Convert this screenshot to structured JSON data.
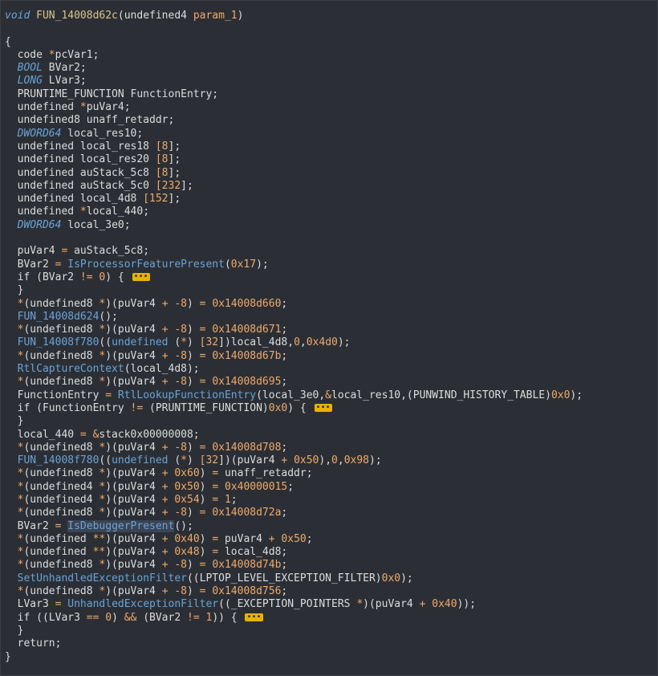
{
  "colors": {
    "background": "#2b2f35",
    "keyword_type": "#6aa3d8",
    "function_name": "#6aa3d8",
    "function_def": "#d7c58a",
    "number": "#f0a96a",
    "fold_marker": "#e8b300"
  },
  "lines": [
    [
      {
        "t": "void",
        "c": "type"
      },
      {
        "t": " "
      },
      {
        "t": "FUN_14008d62c",
        "c": "def"
      },
      {
        "t": "(undefined4 "
      },
      {
        "t": "param_1",
        "c": "param"
      },
      {
        "t": ")"
      }
    ],
    [],
    [
      {
        "t": "{"
      }
    ],
    [
      {
        "t": "  code "
      },
      {
        "t": "*",
        "c": "op"
      },
      {
        "t": "pcVar1;"
      }
    ],
    [
      {
        "t": "  "
      },
      {
        "t": "BOOL",
        "c": "type"
      },
      {
        "t": " BVar2;"
      }
    ],
    [
      {
        "t": "  "
      },
      {
        "t": "LONG",
        "c": "type"
      },
      {
        "t": " LVar3;"
      }
    ],
    [
      {
        "t": "  PRUNTIME_FUNCTION FunctionEntry;"
      }
    ],
    [
      {
        "t": "  undefined "
      },
      {
        "t": "*",
        "c": "op"
      },
      {
        "t": "puVar4;"
      }
    ],
    [
      {
        "t": "  undefined8 unaff_retaddr;"
      }
    ],
    [
      {
        "t": "  "
      },
      {
        "t": "DWORD64",
        "c": "type"
      },
      {
        "t": " local_res10;"
      }
    ],
    [
      {
        "t": "  undefined local_res18 "
      },
      {
        "t": "[",
        "c": "op"
      },
      {
        "t": "8",
        "c": "num"
      },
      {
        "t": "];"
      }
    ],
    [
      {
        "t": "  undefined local_res20 "
      },
      {
        "t": "[",
        "c": "op"
      },
      {
        "t": "8",
        "c": "num"
      },
      {
        "t": "];"
      }
    ],
    [
      {
        "t": "  undefined auStack_5c8 "
      },
      {
        "t": "[",
        "c": "op"
      },
      {
        "t": "8",
        "c": "num"
      },
      {
        "t": "];"
      }
    ],
    [
      {
        "t": "  undefined auStack_5c0 "
      },
      {
        "t": "[",
        "c": "op"
      },
      {
        "t": "232",
        "c": "num"
      },
      {
        "t": "];"
      }
    ],
    [
      {
        "t": "  undefined local_4d8 "
      },
      {
        "t": "[",
        "c": "op"
      },
      {
        "t": "152",
        "c": "num"
      },
      {
        "t": "];"
      }
    ],
    [
      {
        "t": "  undefined "
      },
      {
        "t": "*",
        "c": "op"
      },
      {
        "t": "local_440;"
      }
    ],
    [
      {
        "t": "  "
      },
      {
        "t": "DWORD64",
        "c": "type"
      },
      {
        "t": " local_3e0;"
      }
    ],
    [],
    [
      {
        "t": "  puVar4 "
      },
      {
        "t": "=",
        "c": "op"
      },
      {
        "t": " auStack_5c8;"
      }
    ],
    [
      {
        "t": "  BVar2 "
      },
      {
        "t": "=",
        "c": "op"
      },
      {
        "t": " "
      },
      {
        "t": "IsProcessorFeaturePresent",
        "c": "fn"
      },
      {
        "t": "("
      },
      {
        "t": "0x17",
        "c": "num"
      },
      {
        "t": ");"
      }
    ],
    [
      {
        "t": "  if (BVar2 "
      },
      {
        "t": "!=",
        "c": "op"
      },
      {
        "t": " "
      },
      {
        "t": "0",
        "c": "num"
      },
      {
        "t": ") { "
      },
      {
        "t": "•••",
        "c": "fold"
      }
    ],
    [
      {
        "t": "  }"
      }
    ],
    [
      {
        "t": "  "
      },
      {
        "t": "*",
        "c": "op"
      },
      {
        "t": "(undefined8 "
      },
      {
        "t": "*",
        "c": "op"
      },
      {
        "t": ")(puVar4 "
      },
      {
        "t": "+",
        "c": "op"
      },
      {
        "t": " "
      },
      {
        "t": "-8",
        "c": "num"
      },
      {
        "t": ") "
      },
      {
        "t": "=",
        "c": "op"
      },
      {
        "t": " "
      },
      {
        "t": "0x14008d660",
        "c": "num"
      },
      {
        "t": ";"
      }
    ],
    [
      {
        "t": "  "
      },
      {
        "t": "FUN_14008d624",
        "c": "fn"
      },
      {
        "t": "();"
      }
    ],
    [
      {
        "t": "  "
      },
      {
        "t": "*",
        "c": "op"
      },
      {
        "t": "(undefined8 "
      },
      {
        "t": "*",
        "c": "op"
      },
      {
        "t": ")(puVar4 "
      },
      {
        "t": "+",
        "c": "op"
      },
      {
        "t": " "
      },
      {
        "t": "-8",
        "c": "num"
      },
      {
        "t": ") "
      },
      {
        "t": "=",
        "c": "op"
      },
      {
        "t": " "
      },
      {
        "t": "0x14008d671",
        "c": "num"
      },
      {
        "t": ";"
      }
    ],
    [
      {
        "t": "  "
      },
      {
        "t": "FUN_14008f780",
        "c": "fn"
      },
      {
        "t": "(("
      },
      {
        "t": "undefined",
        "c": "fn"
      },
      {
        "t": " ("
      },
      {
        "t": "*",
        "c": "op"
      },
      {
        "t": ") "
      },
      {
        "t": "[",
        "c": "op"
      },
      {
        "t": "32",
        "c": "num"
      },
      {
        "t": "])local_4d8,"
      },
      {
        "t": "0",
        "c": "num"
      },
      {
        "t": ","
      },
      {
        "t": "0x4d0",
        "c": "num"
      },
      {
        "t": ");"
      }
    ],
    [
      {
        "t": "  "
      },
      {
        "t": "*",
        "c": "op"
      },
      {
        "t": "(undefined8 "
      },
      {
        "t": "*",
        "c": "op"
      },
      {
        "t": ")(puVar4 "
      },
      {
        "t": "+",
        "c": "op"
      },
      {
        "t": " "
      },
      {
        "t": "-8",
        "c": "num"
      },
      {
        "t": ") "
      },
      {
        "t": "=",
        "c": "op"
      },
      {
        "t": " "
      },
      {
        "t": "0x14008d67b",
        "c": "num"
      },
      {
        "t": ";"
      }
    ],
    [
      {
        "t": "  "
      },
      {
        "t": "RtlCaptureContext",
        "c": "fn"
      },
      {
        "t": "(local_4d8);"
      }
    ],
    [
      {
        "t": "  "
      },
      {
        "t": "*",
        "c": "op"
      },
      {
        "t": "(undefined8 "
      },
      {
        "t": "*",
        "c": "op"
      },
      {
        "t": ")(puVar4 "
      },
      {
        "t": "+",
        "c": "op"
      },
      {
        "t": " "
      },
      {
        "t": "-8",
        "c": "num"
      },
      {
        "t": ") "
      },
      {
        "t": "=",
        "c": "op"
      },
      {
        "t": " "
      },
      {
        "t": "0x14008d695",
        "c": "num"
      },
      {
        "t": ";"
      }
    ],
    [
      {
        "t": "  FunctionEntry "
      },
      {
        "t": "=",
        "c": "op"
      },
      {
        "t": " "
      },
      {
        "t": "RtlLookupFunctionEntry",
        "c": "fn"
      },
      {
        "t": "(local_3e0,"
      },
      {
        "t": "&",
        "c": "op"
      },
      {
        "t": "local_res10,(PUNWIND_HISTORY_TABLE)"
      },
      {
        "t": "0x0",
        "c": "num"
      },
      {
        "t": ");"
      }
    ],
    [
      {
        "t": "  if (FunctionEntry "
      },
      {
        "t": "!=",
        "c": "op"
      },
      {
        "t": " (PRUNTIME_FUNCTION)"
      },
      {
        "t": "0x0",
        "c": "num"
      },
      {
        "t": ") { "
      },
      {
        "t": "•••",
        "c": "fold"
      }
    ],
    [
      {
        "t": "  }"
      }
    ],
    [
      {
        "t": "  local_440 "
      },
      {
        "t": "=",
        "c": "op"
      },
      {
        "t": " "
      },
      {
        "t": "&",
        "c": "op"
      },
      {
        "t": "stack0x00000008;"
      }
    ],
    [
      {
        "t": "  "
      },
      {
        "t": "*",
        "c": "op"
      },
      {
        "t": "(undefined8 "
      },
      {
        "t": "*",
        "c": "op"
      },
      {
        "t": ")(puVar4 "
      },
      {
        "t": "+",
        "c": "op"
      },
      {
        "t": " "
      },
      {
        "t": "-8",
        "c": "num"
      },
      {
        "t": ") "
      },
      {
        "t": "=",
        "c": "op"
      },
      {
        "t": " "
      },
      {
        "t": "0x14008d708",
        "c": "num"
      },
      {
        "t": ";"
      }
    ],
    [
      {
        "t": "  "
      },
      {
        "t": "FUN_14008f780",
        "c": "fn"
      },
      {
        "t": "(("
      },
      {
        "t": "undefined",
        "c": "fn"
      },
      {
        "t": " ("
      },
      {
        "t": "*",
        "c": "op"
      },
      {
        "t": ") "
      },
      {
        "t": "[",
        "c": "op"
      },
      {
        "t": "32",
        "c": "num"
      },
      {
        "t": "])(puVar4 "
      },
      {
        "t": "+",
        "c": "op"
      },
      {
        "t": " "
      },
      {
        "t": "0x50",
        "c": "num"
      },
      {
        "t": "),"
      },
      {
        "t": "0",
        "c": "num"
      },
      {
        "t": ","
      },
      {
        "t": "0x98",
        "c": "num"
      },
      {
        "t": ");"
      }
    ],
    [
      {
        "t": "  "
      },
      {
        "t": "*",
        "c": "op"
      },
      {
        "t": "(undefined8 "
      },
      {
        "t": "*",
        "c": "op"
      },
      {
        "t": ")(puVar4 "
      },
      {
        "t": "+",
        "c": "op"
      },
      {
        "t": " "
      },
      {
        "t": "0x60",
        "c": "num"
      },
      {
        "t": ") "
      },
      {
        "t": "=",
        "c": "op"
      },
      {
        "t": " unaff_retaddr;"
      }
    ],
    [
      {
        "t": "  "
      },
      {
        "t": "*",
        "c": "op"
      },
      {
        "t": "(undefined4 "
      },
      {
        "t": "*",
        "c": "op"
      },
      {
        "t": ")(puVar4 "
      },
      {
        "t": "+",
        "c": "op"
      },
      {
        "t": " "
      },
      {
        "t": "0x50",
        "c": "num"
      },
      {
        "t": ") "
      },
      {
        "t": "=",
        "c": "op"
      },
      {
        "t": " "
      },
      {
        "t": "0x40000015",
        "c": "num"
      },
      {
        "t": ";"
      }
    ],
    [
      {
        "t": "  "
      },
      {
        "t": "*",
        "c": "op"
      },
      {
        "t": "(undefined4 "
      },
      {
        "t": "*",
        "c": "op"
      },
      {
        "t": ")(puVar4 "
      },
      {
        "t": "+",
        "c": "op"
      },
      {
        "t": " "
      },
      {
        "t": "0x54",
        "c": "num"
      },
      {
        "t": ") "
      },
      {
        "t": "=",
        "c": "op"
      },
      {
        "t": " "
      },
      {
        "t": "1",
        "c": "num"
      },
      {
        "t": ";"
      }
    ],
    [
      {
        "t": "  "
      },
      {
        "t": "*",
        "c": "op"
      },
      {
        "t": "(undefined8 "
      },
      {
        "t": "*",
        "c": "op"
      },
      {
        "t": ")(puVar4 "
      },
      {
        "t": "+",
        "c": "op"
      },
      {
        "t": " "
      },
      {
        "t": "-8",
        "c": "num"
      },
      {
        "t": ") "
      },
      {
        "t": "=",
        "c": "op"
      },
      {
        "t": " "
      },
      {
        "t": "0x14008d72a",
        "c": "num"
      },
      {
        "t": ";"
      }
    ],
    [
      {
        "t": "  BVar2 "
      },
      {
        "t": "=",
        "c": "op"
      },
      {
        "t": " "
      },
      {
        "t": "IsDebuggerPresent",
        "c": "hl"
      },
      {
        "t": "();"
      }
    ],
    [
      {
        "t": "  "
      },
      {
        "t": "*",
        "c": "op"
      },
      {
        "t": "(undefined "
      },
      {
        "t": "**",
        "c": "op"
      },
      {
        "t": ")(puVar4 "
      },
      {
        "t": "+",
        "c": "op"
      },
      {
        "t": " "
      },
      {
        "t": "0x40",
        "c": "num"
      },
      {
        "t": ") "
      },
      {
        "t": "=",
        "c": "op"
      },
      {
        "t": " puVar4 "
      },
      {
        "t": "+",
        "c": "op"
      },
      {
        "t": " "
      },
      {
        "t": "0x50",
        "c": "num"
      },
      {
        "t": ";"
      }
    ],
    [
      {
        "t": "  "
      },
      {
        "t": "*",
        "c": "op"
      },
      {
        "t": "(undefined "
      },
      {
        "t": "**",
        "c": "op"
      },
      {
        "t": ")(puVar4 "
      },
      {
        "t": "+",
        "c": "op"
      },
      {
        "t": " "
      },
      {
        "t": "0x48",
        "c": "num"
      },
      {
        "t": ") "
      },
      {
        "t": "=",
        "c": "op"
      },
      {
        "t": " local_4d8;"
      }
    ],
    [
      {
        "t": "  "
      },
      {
        "t": "*",
        "c": "op"
      },
      {
        "t": "(undefined8 "
      },
      {
        "t": "*",
        "c": "op"
      },
      {
        "t": ")(puVar4 "
      },
      {
        "t": "+",
        "c": "op"
      },
      {
        "t": " "
      },
      {
        "t": "-8",
        "c": "num"
      },
      {
        "t": ") "
      },
      {
        "t": "=",
        "c": "op"
      },
      {
        "t": " "
      },
      {
        "t": "0x14008d74b",
        "c": "num"
      },
      {
        "t": ";"
      }
    ],
    [
      {
        "t": "  "
      },
      {
        "t": "SetUnhandledExceptionFilter",
        "c": "fn"
      },
      {
        "t": "((LPTOP_LEVEL_EXCEPTION_FILTER)"
      },
      {
        "t": "0x0",
        "c": "num"
      },
      {
        "t": ");"
      }
    ],
    [
      {
        "t": "  "
      },
      {
        "t": "*",
        "c": "op"
      },
      {
        "t": "(undefined8 "
      },
      {
        "t": "*",
        "c": "op"
      },
      {
        "t": ")(puVar4 "
      },
      {
        "t": "+",
        "c": "op"
      },
      {
        "t": " "
      },
      {
        "t": "-8",
        "c": "num"
      },
      {
        "t": ") "
      },
      {
        "t": "=",
        "c": "op"
      },
      {
        "t": " "
      },
      {
        "t": "0x14008d756",
        "c": "num"
      },
      {
        "t": ";"
      }
    ],
    [
      {
        "t": "  LVar3 "
      },
      {
        "t": "=",
        "c": "op"
      },
      {
        "t": " "
      },
      {
        "t": "UnhandledExceptionFilter",
        "c": "fn"
      },
      {
        "t": "((_EXCEPTION_POINTERS "
      },
      {
        "t": "*",
        "c": "op"
      },
      {
        "t": ")(puVar4 "
      },
      {
        "t": "+",
        "c": "op"
      },
      {
        "t": " "
      },
      {
        "t": "0x40",
        "c": "num"
      },
      {
        "t": "));"
      }
    ],
    [
      {
        "t": "  if ((LVar3 "
      },
      {
        "t": "==",
        "c": "op"
      },
      {
        "t": " "
      },
      {
        "t": "0",
        "c": "num"
      },
      {
        "t": ") "
      },
      {
        "t": "&&",
        "c": "op"
      },
      {
        "t": " (BVar2 "
      },
      {
        "t": "!=",
        "c": "op"
      },
      {
        "t": " "
      },
      {
        "t": "1",
        "c": "num"
      },
      {
        "t": ")) { "
      },
      {
        "t": "•••",
        "c": "fold"
      }
    ],
    [
      {
        "t": "  }"
      }
    ],
    [
      {
        "t": "  return;"
      }
    ],
    [
      {
        "t": "}"
      }
    ]
  ]
}
